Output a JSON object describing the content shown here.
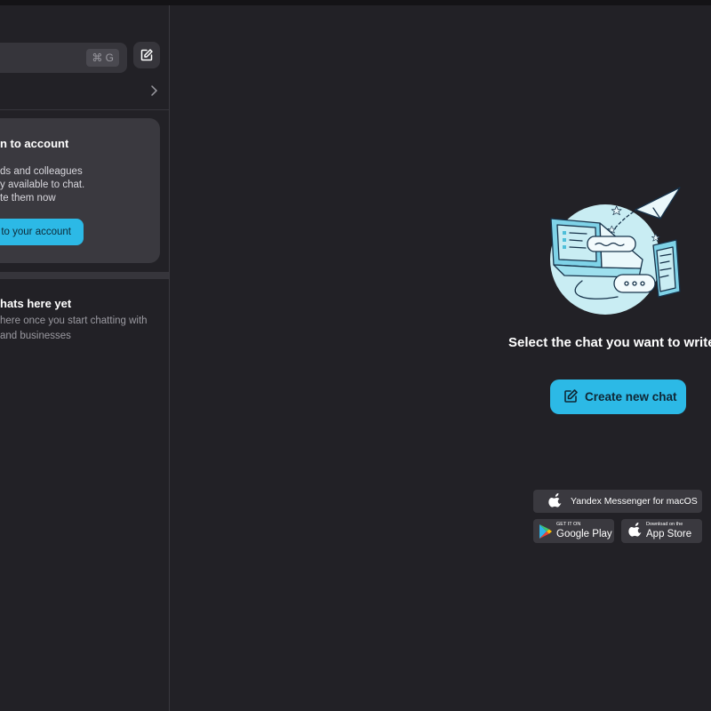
{
  "sidebar": {
    "search": {
      "placeholder": "",
      "shortcut": "⌘ G"
    },
    "signin_card": {
      "title": "n to account",
      "lines": [
        "ds and colleagues",
        "y available to chat.",
        "te them now"
      ],
      "button_label": "to your account"
    },
    "empty_state": {
      "title": "hats here yet",
      "lines": [
        "here once you start chatting with",
        "and businesses"
      ]
    }
  },
  "main": {
    "prompt": "Select the chat you want to write",
    "create_button_label": "Create new chat",
    "stores": {
      "macos_label": "Yandex Messenger for macOS",
      "google_small": "GET IT ON",
      "google_big": "Google Play",
      "apple_small": "Download on the",
      "apple_big": "App Store"
    }
  },
  "colors": {
    "accent": "#2cb9e6",
    "background": "#222126",
    "panel": "#3a393f"
  },
  "icons": [
    "compose-icon",
    "chevron-right-icon",
    "apple-icon",
    "google-play-icon",
    "edit-icon"
  ]
}
